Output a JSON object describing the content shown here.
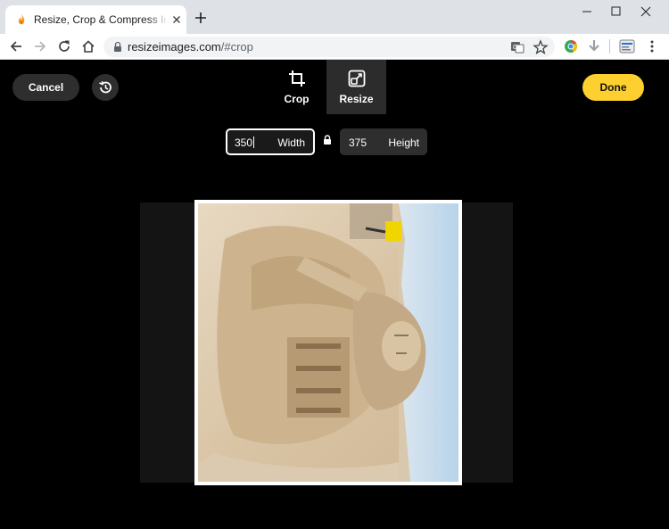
{
  "browser": {
    "tab_title": "Resize, Crop & Compress Images",
    "url_host": "resizeimages.com",
    "url_path": "/#crop"
  },
  "app": {
    "cancel_label": "Cancel",
    "done_label": "Done",
    "modes": [
      {
        "label": "Crop",
        "icon": "crop-icon",
        "active": false
      },
      {
        "label": "Resize",
        "icon": "resize-icon",
        "active": true
      }
    ],
    "width": {
      "value": "350",
      "label": "Width"
    },
    "height": {
      "value": "375",
      "label": "Height"
    },
    "accent_color": "#fed02f"
  }
}
